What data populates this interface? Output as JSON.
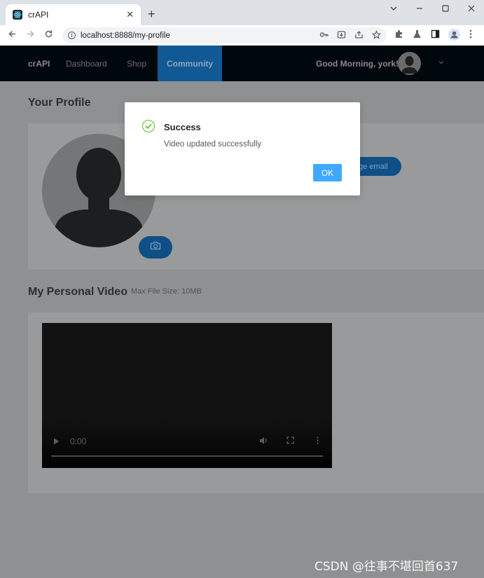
{
  "browser": {
    "tab_title": "crAPI",
    "url": "localhost:8888/my-profile",
    "new_tab_symbol": "+",
    "close_symbol": "✕"
  },
  "nav": {
    "brand": "crAPI",
    "items": [
      "Dashboard",
      "Shop",
      "Community"
    ],
    "active": "Community",
    "greeting": "Good Morning, york!"
  },
  "profile": {
    "title": "Your Profile",
    "change_email_label": "ge email"
  },
  "video": {
    "title": "My Personal Video",
    "max_size": "Max File Size: 10MB",
    "current_time": "0:00"
  },
  "modal": {
    "title": "Success",
    "message": "Video updated successfully",
    "ok_label": "OK"
  },
  "watermark": "CSDN @往事不堪回首637",
  "colors": {
    "accent": "#40a9ff",
    "success": "#52c41a",
    "nav_bg": "#00070d",
    "active_nav": "#115995"
  }
}
